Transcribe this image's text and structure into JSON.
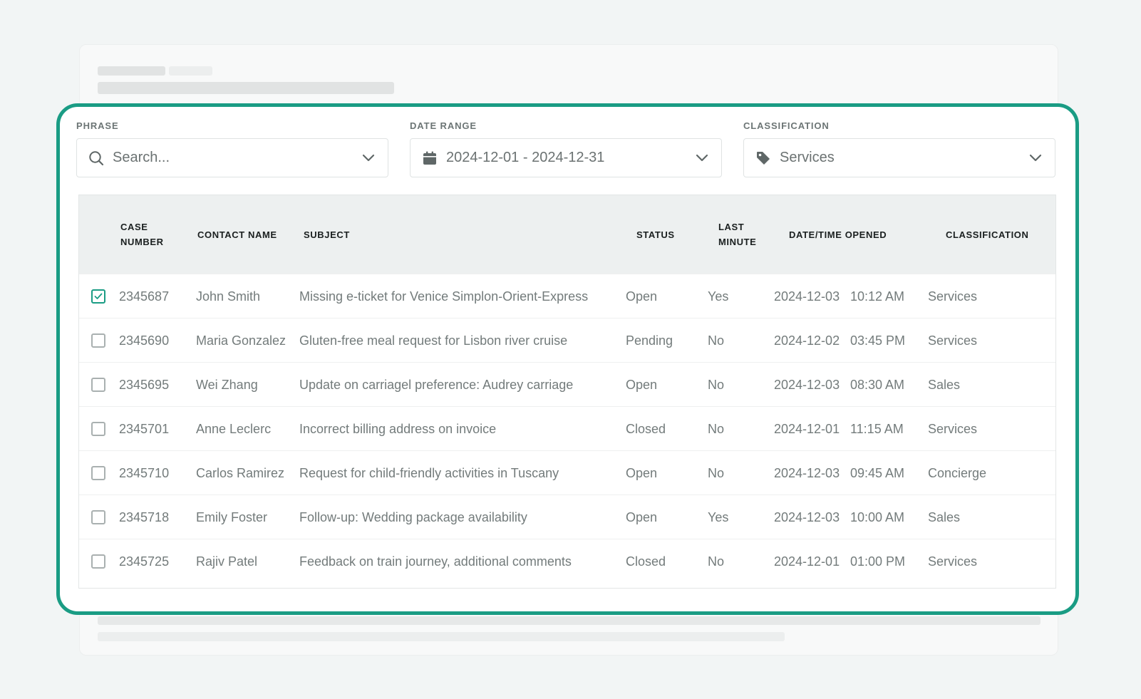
{
  "filters": {
    "phrase": {
      "label": "PHRASE",
      "placeholder": "Search..."
    },
    "date_range": {
      "label": "DATE RANGE",
      "value": "2024-12-01 - 2024-12-31"
    },
    "classification": {
      "label": "CLASSIFICATION",
      "value": "Services"
    }
  },
  "table": {
    "headers": {
      "case_number": "CASE NUMBER",
      "contact_name": "CONTACT NAME",
      "subject": "SUBJECT",
      "status": "STATUS",
      "last_minute": "LAST MINUTE",
      "date_opened": "DATE/TIME OPENED",
      "classification": "CLASSIFICATION"
    },
    "rows": [
      {
        "checked": true,
        "case": "2345687",
        "contact": "John Smith",
        "subject": "Missing e-ticket for Venice Simplon-Orient-Express",
        "status": "Open",
        "last_minute": "Yes",
        "date": "2024-12-03",
        "time": "10:12 AM",
        "classification": "Services"
      },
      {
        "checked": false,
        "case": "2345690",
        "contact": "Maria Gonzalez",
        "subject": "Gluten-free meal request for Lisbon river cruise",
        "status": "Pending",
        "last_minute": "No",
        "date": "2024-12-02",
        "time": "03:45 PM",
        "classification": "Services"
      },
      {
        "checked": false,
        "case": "2345695",
        "contact": "Wei Zhang",
        "subject": "Update on carriagel preference: Audrey carriage",
        "status": "Open",
        "last_minute": "No",
        "date": "2024-12-03",
        "time": "08:30 AM",
        "classification": "Sales"
      },
      {
        "checked": false,
        "case": "2345701",
        "contact": "Anne Leclerc",
        "subject": "Incorrect billing address on invoice",
        "status": "Closed",
        "last_minute": "No",
        "date": "2024-12-01",
        "time": "11:15 AM",
        "classification": "Services"
      },
      {
        "checked": false,
        "case": "2345710",
        "contact": "Carlos Ramirez",
        "subject": "Request for child-friendly activities in Tuscany",
        "status": "Open",
        "last_minute": "No",
        "date": "2024-12-03",
        "time": "09:45 AM",
        "classification": "Concierge"
      },
      {
        "checked": false,
        "case": "2345718",
        "contact": "Emily Foster",
        "subject": "Follow-up: Wedding package availability",
        "status": "Open",
        "last_minute": "Yes",
        "date": "2024-12-03",
        "time": "10:00 AM",
        "classification": "Sales"
      },
      {
        "checked": false,
        "case": "2345725",
        "contact": "Rajiv Patel",
        "subject": "Feedback on train journey, additional comments",
        "status": "Closed",
        "last_minute": "No",
        "date": "2024-12-01",
        "time": "01:00 PM",
        "classification": "Services"
      }
    ]
  },
  "colors": {
    "accent": "#1a9c84",
    "header_bg": "#edf0f0",
    "text_muted": "#737b7b",
    "page_bg": "#f2f5f5"
  },
  "icons": {
    "phrase": "search-icon",
    "date_range": "calendar-icon",
    "classification": "tag-icon",
    "dropdown": "chevron-down-icon",
    "row_select": "checkbox-icon"
  }
}
